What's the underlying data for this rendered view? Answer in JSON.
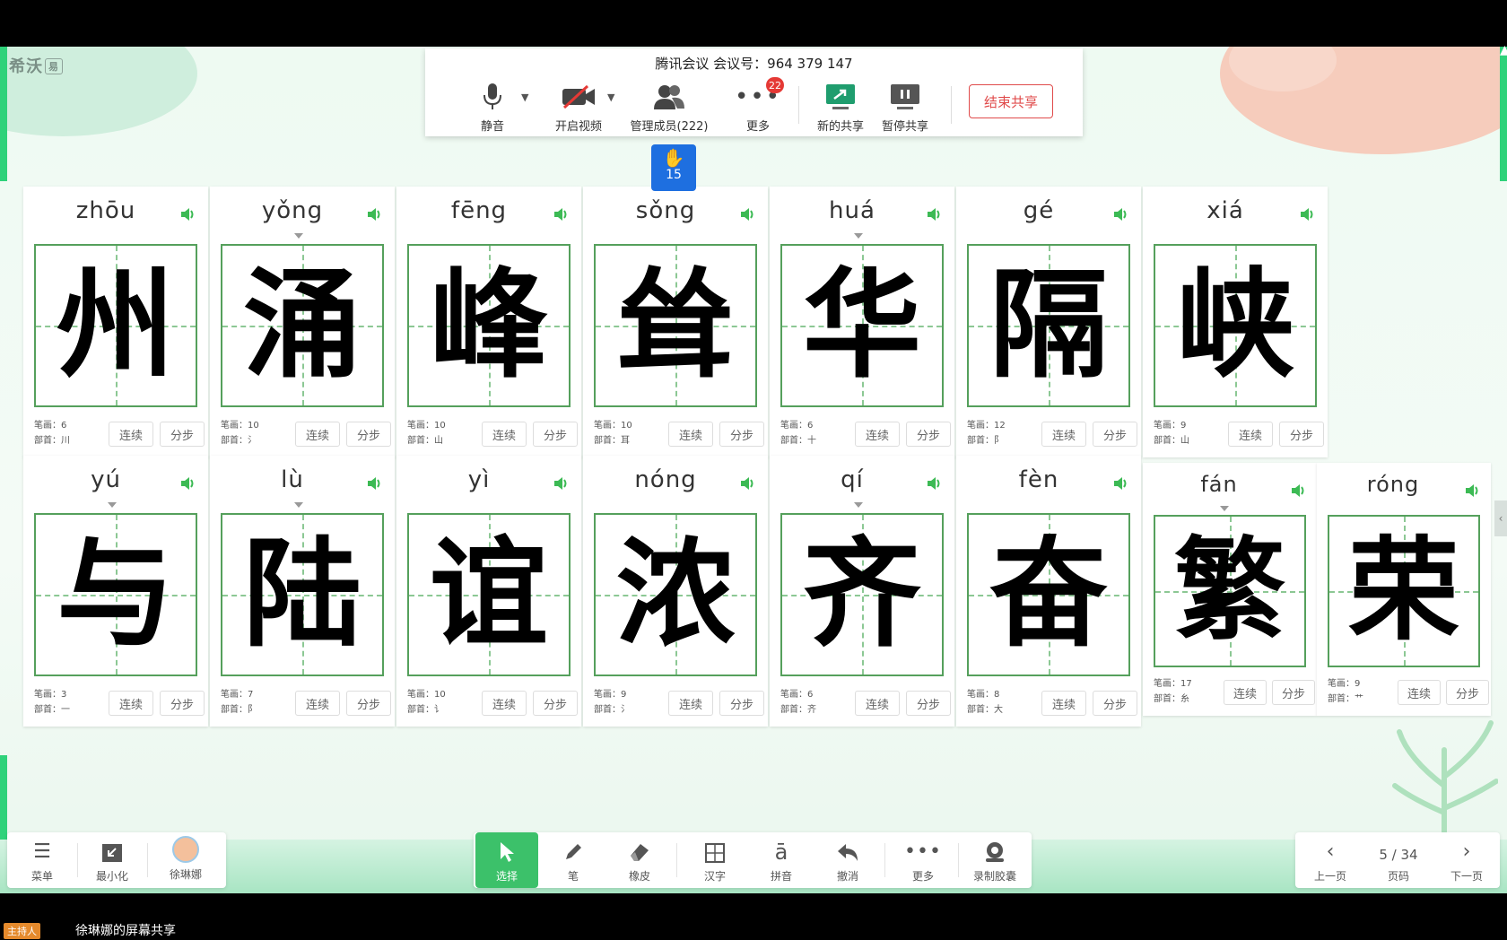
{
  "meeting": {
    "title": "腾讯会议 会议号：964 379 147",
    "tools": [
      {
        "label": "静音",
        "icon": "microphone-icon"
      },
      {
        "label": "开启视频",
        "icon": "video-off-icon"
      },
      {
        "label": "管理成员(222)",
        "icon": "members-icon"
      },
      {
        "label": "更多",
        "icon": "more-icon",
        "badge": "22"
      },
      {
        "label": "新的共享",
        "icon": "new-share-icon"
      },
      {
        "label": "暂停共享",
        "icon": "pause-share-icon"
      }
    ],
    "end_share": "结束共享",
    "raised_hands": "15"
  },
  "logo": {
    "name": "希沃",
    "suffix": "易"
  },
  "cards": [
    {
      "pinyin": "zhōu",
      "char": "州",
      "strokes": "笔画：6",
      "radical": "部首：川"
    },
    {
      "pinyin": "yǒng",
      "char": "涌",
      "strokes": "笔画：10",
      "radical": "部首：氵"
    },
    {
      "pinyin": "fēng",
      "char": "峰",
      "strokes": "笔画：10",
      "radical": "部首：山"
    },
    {
      "pinyin": "sǒng",
      "char": "耸",
      "strokes": "笔画：10",
      "radical": "部首：耳"
    },
    {
      "pinyin": "huá",
      "char": "华",
      "strokes": "笔画：6",
      "radical": "部首：十"
    },
    {
      "pinyin": "gé",
      "char": "隔",
      "strokes": "笔画：12",
      "radical": "部首：阝"
    },
    {
      "pinyin": "xiá",
      "char": "峡",
      "strokes": "笔画：9",
      "radical": "部首：山"
    },
    {
      "pinyin": "yú",
      "char": "与",
      "strokes": "笔画：3",
      "radical": "部首：一"
    },
    {
      "pinyin": "lù",
      "char": "陆",
      "strokes": "笔画：7",
      "radical": "部首：阝"
    },
    {
      "pinyin": "yì",
      "char": "谊",
      "strokes": "笔画：10",
      "radical": "部首：讠"
    },
    {
      "pinyin": "nóng",
      "char": "浓",
      "strokes": "笔画：9",
      "radical": "部首：氵"
    },
    {
      "pinyin": "qí",
      "char": "齐",
      "strokes": "笔画：6",
      "radical": "部首：齐"
    },
    {
      "pinyin": "fèn",
      "char": "奋",
      "strokes": "笔画：8",
      "radical": "部首：大"
    },
    {
      "pinyin": "fán",
      "char": "繁",
      "strokes": "笔画：17",
      "radical": "部首：糸"
    },
    {
      "pinyin": "róng",
      "char": "荣",
      "strokes": "笔画：9",
      "radical": "部首：艹"
    }
  ],
  "card_buttons": {
    "continuous": "连续",
    "step": "分步"
  },
  "toolbar_left": [
    {
      "label": "菜单",
      "icon": "menu-icon"
    },
    {
      "label": "最小化",
      "icon": "minimize-icon"
    },
    {
      "label": "徐琳娜",
      "icon": "avatar"
    }
  ],
  "toolbar_center": [
    {
      "label": "选择",
      "icon": "select-cursor-icon",
      "active": true
    },
    {
      "label": "笔",
      "icon": "pen-icon"
    },
    {
      "label": "橡皮",
      "icon": "eraser-icon"
    },
    {
      "label": "汉字",
      "icon": "hanzi-grid-icon"
    },
    {
      "label": "拼音",
      "icon": "pinyin-icon"
    },
    {
      "label": "撤消",
      "icon": "undo-icon"
    },
    {
      "label": "更多",
      "icon": "more-icon"
    },
    {
      "label": "录制胶囊",
      "icon": "record-capsule-icon"
    }
  ],
  "toolbar_right": {
    "prev": "上一页",
    "page": "5 / 34",
    "page_label": "页码",
    "next": "下一页"
  },
  "status": {
    "host": "主持人",
    "sharing": "徐琳娜的屏幕共享"
  },
  "colors": {
    "grid_border": "#55a05c",
    "accent": "#3cc16a",
    "end_share": "#e04b4b",
    "hand_raise": "#1e6fe0"
  }
}
